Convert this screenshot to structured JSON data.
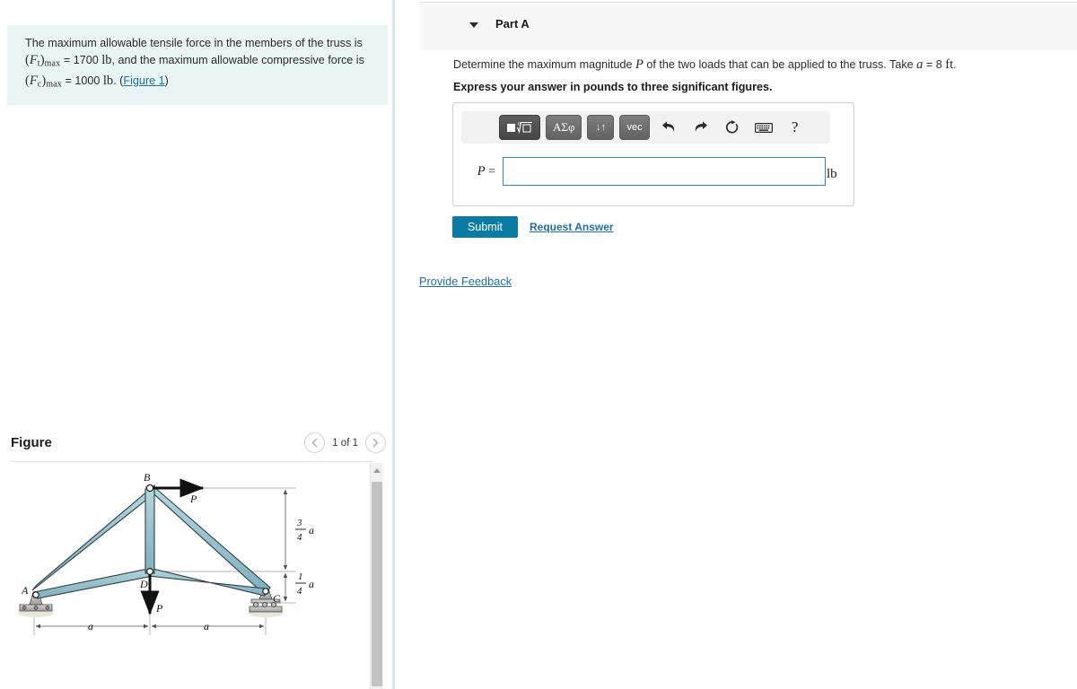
{
  "problem": {
    "line1": "The maximum allowable tensile force in the members of the truss is",
    "line2_sym": "F",
    "line2_sub": "t",
    "line2_sub_label": "max",
    "line2_value": "1700",
    "line2_unit": "lb",
    "line2_tail": ", and the maximum allowable compressive force is",
    "line3_sym": "F",
    "line3_sub": "c",
    "line3_sub_label": "max",
    "line3_value": "1000",
    "line3_unit": "lb",
    "figure_link": "Figure 1"
  },
  "figure": {
    "title": "Figure",
    "pager_label": "1 of 1",
    "prev_icon": "chevron-left-icon",
    "next_icon": "chevron-right-icon",
    "scroll_up_icon": "triangle-up-icon",
    "diagram": {
      "nodes": [
        "A",
        "B",
        "C",
        "D"
      ],
      "load_top_label": "P",
      "load_bottom_label": "P",
      "dim_vertical_upper_num": "3",
      "dim_vertical_upper_den": "4",
      "dim_vertical_upper_var": "a",
      "dim_vertical_lower_num": "1",
      "dim_vertical_lower_den": "4",
      "dim_vertical_lower_var": "a",
      "dim_horizontal_left": "a",
      "dim_horizontal_right": "a",
      "member_color": "#9cc3ce",
      "member_edge_color": "#2c3e46",
      "support_color": "#b5b5b5"
    }
  },
  "part": {
    "title": "Part A",
    "collapse_icon": "chevron-down-icon",
    "question_pre": "Determine the maximum magnitude ",
    "question_sym": "P",
    "question_mid": " of the two loads that can be applied to the truss. Take ",
    "question_var": "a",
    "question_eq": " = 8 ",
    "question_unit": "ft",
    "question_end": ".",
    "instruction": "Express your answer in pounds to three significant figures."
  },
  "answer": {
    "toolbar": {
      "template_icon": "math-template-icon",
      "greek_label": "ΑΣφ",
      "updown_label": "↓↑",
      "vec_label": "vec",
      "undo_icon": "undo-icon",
      "redo_icon": "redo-icon",
      "reset_icon": "reset-icon",
      "keyboard_icon": "keyboard-icon",
      "help_label": "?"
    },
    "label_sym": "P",
    "label_eq": " =",
    "value": "",
    "placeholder": "",
    "units": "lb",
    "submit_label": "Submit",
    "request_answer_label": "Request Answer"
  },
  "footer": {
    "provide_feedback_label": "Provide Feedback"
  },
  "colors": {
    "accent": "#0a7ba3",
    "link": "#1f6fa8",
    "problem_bg": "#e9f5f4",
    "input_border": "#2f8bb5"
  }
}
